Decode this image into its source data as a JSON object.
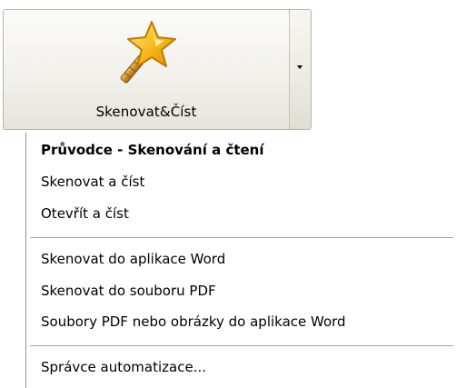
{
  "button": {
    "label": "Skenovat&Číst",
    "icon": "magic-wand-star-icon",
    "dropdown_icon": "triangle-down-icon"
  },
  "menu": {
    "groups": [
      {
        "items": [
          {
            "label": "Průvodce - Skenování a čtení",
            "bold": true
          },
          {
            "label": "Skenovat a číst"
          },
          {
            "label": "Otevřít a číst"
          }
        ]
      },
      {
        "items": [
          {
            "label": "Skenovat do aplikace Word"
          },
          {
            "label": "Skenovat do souboru PDF"
          },
          {
            "label": "Soubory PDF nebo obrázky do aplikace Word"
          }
        ]
      },
      {
        "items": [
          {
            "label": "Správce automatizace..."
          }
        ]
      }
    ]
  },
  "colors": {
    "star_fill": "#f5b81c",
    "star_outline": "#c07a00",
    "wand": "#c9851a"
  }
}
